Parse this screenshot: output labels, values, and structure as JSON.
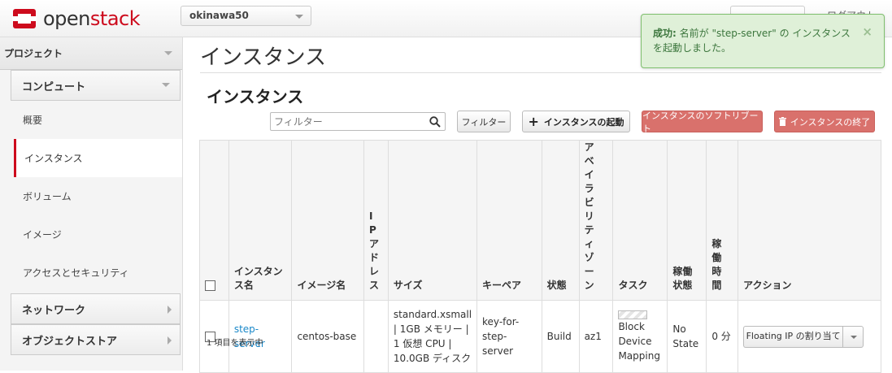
{
  "app": {
    "brand_prefix": "open",
    "brand_suffix": "stack"
  },
  "header": {
    "project": "okinawa50",
    "logout": "ログアウト"
  },
  "sidebar": {
    "project": "プロジェクト",
    "compute": "コンピュート",
    "items": [
      {
        "label": "概要"
      },
      {
        "label": "インスタンス"
      },
      {
        "label": "ボリューム"
      },
      {
        "label": "イメージ"
      },
      {
        "label": "アクセスとセキュリティ"
      }
    ],
    "network": "ネットワーク",
    "object_store": "オブジェクトストア"
  },
  "main": {
    "page_title": "インスタンス",
    "section_title": "インスタンス",
    "search_placeholder": "フィルター",
    "filter_button": "フィルター",
    "launch_button": "インスタンスの起動",
    "soft_reboot_button": "インスタンスのソフトリブート",
    "terminate_button": "インスタンスの終了",
    "footer": "1 項目を表示中"
  },
  "table": {
    "headers": {
      "name": "インスタンス名",
      "image": "イメージ名",
      "ip": "IPアドレス",
      "size": "サイズ",
      "keypair": "キーペア",
      "status": "状態",
      "az": "アベイラビリティゾーン",
      "task": "タスク",
      "power": "稼働状態",
      "uptime": "稼働時間",
      "actions": "アクション"
    },
    "rows": [
      {
        "name": "step-server",
        "image": "centos-base",
        "ip": "",
        "size": "standard.xsmall | 1GB メモリー | 1 仮想 CPU | 10.0GB ディスク",
        "keypair": "key-for-step-server",
        "status": "Build",
        "az": "az1",
        "task": "Block Device Mapping",
        "power": "No State",
        "uptime": "0 分",
        "action": "Floating IP の割り当て"
      }
    ]
  },
  "toast": {
    "title": "成功:",
    "message": " 名前が \"step-server\" の インスタンス を起動しました。",
    "close": "×"
  },
  "colors": {
    "brand": "#cd0b1d",
    "danger": "#d9716c",
    "success_bg": "#dff0d8",
    "link": "#1a88c9"
  }
}
